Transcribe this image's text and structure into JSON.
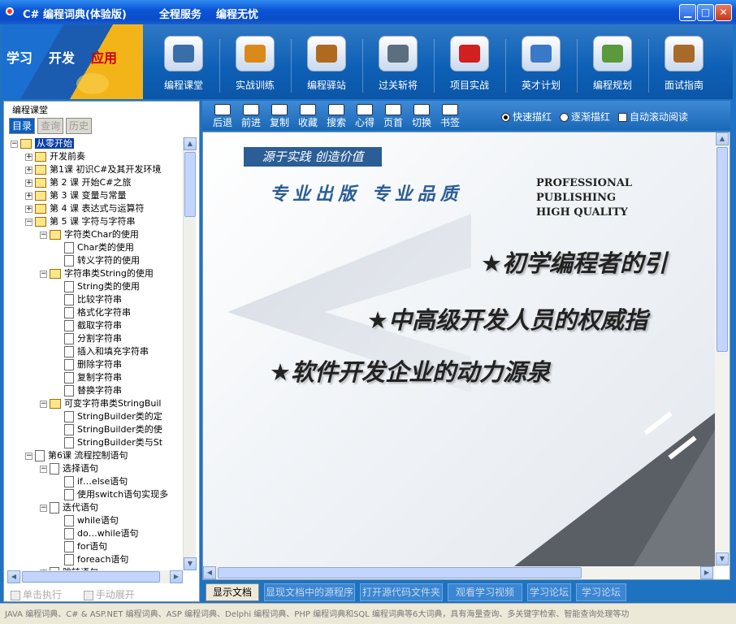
{
  "window": {
    "app_title": "C# 编程词典(体验版)",
    "slogan1": "全程服务",
    "slogan2": "编程无忧",
    "minimize": "▁",
    "maximize": "□",
    "close": "✕"
  },
  "banner": {
    "logo_words": [
      "学习",
      "开发",
      "应用"
    ],
    "nav": [
      {
        "label": "编程课堂",
        "icon": "teacher-icon",
        "color": "#3a6ea8"
      },
      {
        "label": "实战训练",
        "icon": "monitor-gear-icon",
        "color": "#d98a1a"
      },
      {
        "label": "编程驿站",
        "icon": "house-icon",
        "color": "#b06a20"
      },
      {
        "label": "过关斩将",
        "icon": "gate-icon",
        "color": "#5b6f80"
      },
      {
        "label": "项目实战",
        "icon": "target-icon",
        "color": "#d02020"
      },
      {
        "label": "英才计划",
        "icon": "people-icon",
        "color": "#3a78c8"
      },
      {
        "label": "编程规划",
        "icon": "notebook-icon",
        "color": "#5a9a3a"
      },
      {
        "label": "面试指南",
        "icon": "signpost-icon",
        "color": "#a86a2a"
      }
    ]
  },
  "left": {
    "title": "编程课堂",
    "tabs": [
      "目录",
      "查询",
      "历史"
    ],
    "tree": [
      {
        "label": "从零开始",
        "kind": "folder",
        "exp": "−"
      },
      {
        "label": "开发前奏",
        "kind": "folder",
        "exp": "+"
      },
      {
        "label": "第1课  初识C#及其开发环境",
        "kind": "folder",
        "exp": "+"
      },
      {
        "label": "第 2 课  开始C#之旅",
        "kind": "folder",
        "exp": "+"
      },
      {
        "label": "第 3 课  变量与常量",
        "kind": "folder",
        "exp": "+"
      },
      {
        "label": "第 4 课  表达式与运算符",
        "kind": "folder",
        "exp": "+"
      },
      {
        "label": "第 5 课  字符与字符串",
        "kind": "folder",
        "exp": "−"
      },
      {
        "label": "字符类Char的使用",
        "kind": "folder",
        "exp": "−"
      },
      {
        "label": "Char类的使用",
        "kind": "doc",
        "exp": ""
      },
      {
        "label": "转义字符的使用",
        "kind": "doc",
        "exp": ""
      },
      {
        "label": "字符串类String的使用",
        "kind": "folder",
        "exp": "−"
      },
      {
        "label": "String类的使用",
        "kind": "doc",
        "exp": ""
      },
      {
        "label": "比较字符串",
        "kind": "doc",
        "exp": ""
      },
      {
        "label": "格式化字符串",
        "kind": "doc",
        "exp": ""
      },
      {
        "label": "截取字符串",
        "kind": "doc",
        "exp": ""
      },
      {
        "label": "分割字符串",
        "kind": "doc",
        "exp": ""
      },
      {
        "label": "插入和填充字符串",
        "kind": "doc",
        "exp": ""
      },
      {
        "label": "删除字符串",
        "kind": "doc",
        "exp": ""
      },
      {
        "label": "复制字符串",
        "kind": "doc",
        "exp": ""
      },
      {
        "label": "替换字符串",
        "kind": "doc",
        "exp": ""
      },
      {
        "label": "可变字符串类StringBuil",
        "kind": "folder",
        "exp": "−"
      },
      {
        "label": "StringBuilder类的定",
        "kind": "doc",
        "exp": ""
      },
      {
        "label": "StringBuilder类的使",
        "kind": "doc",
        "exp": ""
      },
      {
        "label": "StringBuilder类与St",
        "kind": "doc",
        "exp": ""
      },
      {
        "label": "第6课  流程控制语句",
        "kind": "doc",
        "exp": "−"
      },
      {
        "label": "选择语句",
        "kind": "doc",
        "exp": "−"
      },
      {
        "label": "if…else语句",
        "kind": "doc",
        "exp": ""
      },
      {
        "label": "使用switch语句实现多",
        "kind": "doc",
        "exp": ""
      },
      {
        "label": "迭代语句",
        "kind": "doc",
        "exp": "−"
      },
      {
        "label": "while语句",
        "kind": "doc",
        "exp": ""
      },
      {
        "label": "do…while语句",
        "kind": "doc",
        "exp": ""
      },
      {
        "label": "for语句",
        "kind": "doc",
        "exp": ""
      },
      {
        "label": "foreach语句",
        "kind": "doc",
        "exp": ""
      },
      {
        "label": "跳转语句",
        "kind": "doc",
        "exp": "+"
      }
    ],
    "bottom_click": "单击执行",
    "bottom_expand": "手动展开"
  },
  "toolbar": {
    "buttons": [
      {
        "label": "后退",
        "icon": "back-arrow-icon"
      },
      {
        "label": "前进",
        "icon": "forward-arrow-icon"
      },
      {
        "label": "复制",
        "icon": "check-icon"
      },
      {
        "label": "收藏",
        "icon": "bookmark-icon"
      },
      {
        "label": "搜索",
        "icon": "magnifier-icon"
      },
      {
        "label": "心得",
        "icon": "crown-icon"
      },
      {
        "label": "页首",
        "icon": "cursor-icon"
      },
      {
        "label": "切换",
        "icon": "switch-icon"
      },
      {
        "label": "书签",
        "icon": "bookmark-board-icon"
      }
    ],
    "opt_fast": "快速描红",
    "opt_gradual": "逐渐描红",
    "opt_autoscroll": "自动滚动阅读"
  },
  "content": {
    "slogan": "源于实践  创造价值",
    "headline_cn": "专业出版  专业品质",
    "headline_en1": "PROFESSIONAL PUBLISHING",
    "headline_en2": "HIGH QUALITY",
    "star1": "★初学编程者的引",
    "star2": "★中高级开发人员的权威指",
    "star3": "★软件开发企业的动力源泉"
  },
  "bottom_tabs": [
    "显示文档",
    "显现文档中的源程序",
    "打开源代码文件夹",
    "观看学习视频",
    "学习论坛",
    "学习论坛"
  ],
  "status": "JAVA 编程词典、C# & ASP.NET 编程词典、ASP 编程词典、Delphi 编程词典、PHP 编程词典和SQL 编程词典等6大词典，具有海量查询、多关键字检索、智能查询处理等功"
}
